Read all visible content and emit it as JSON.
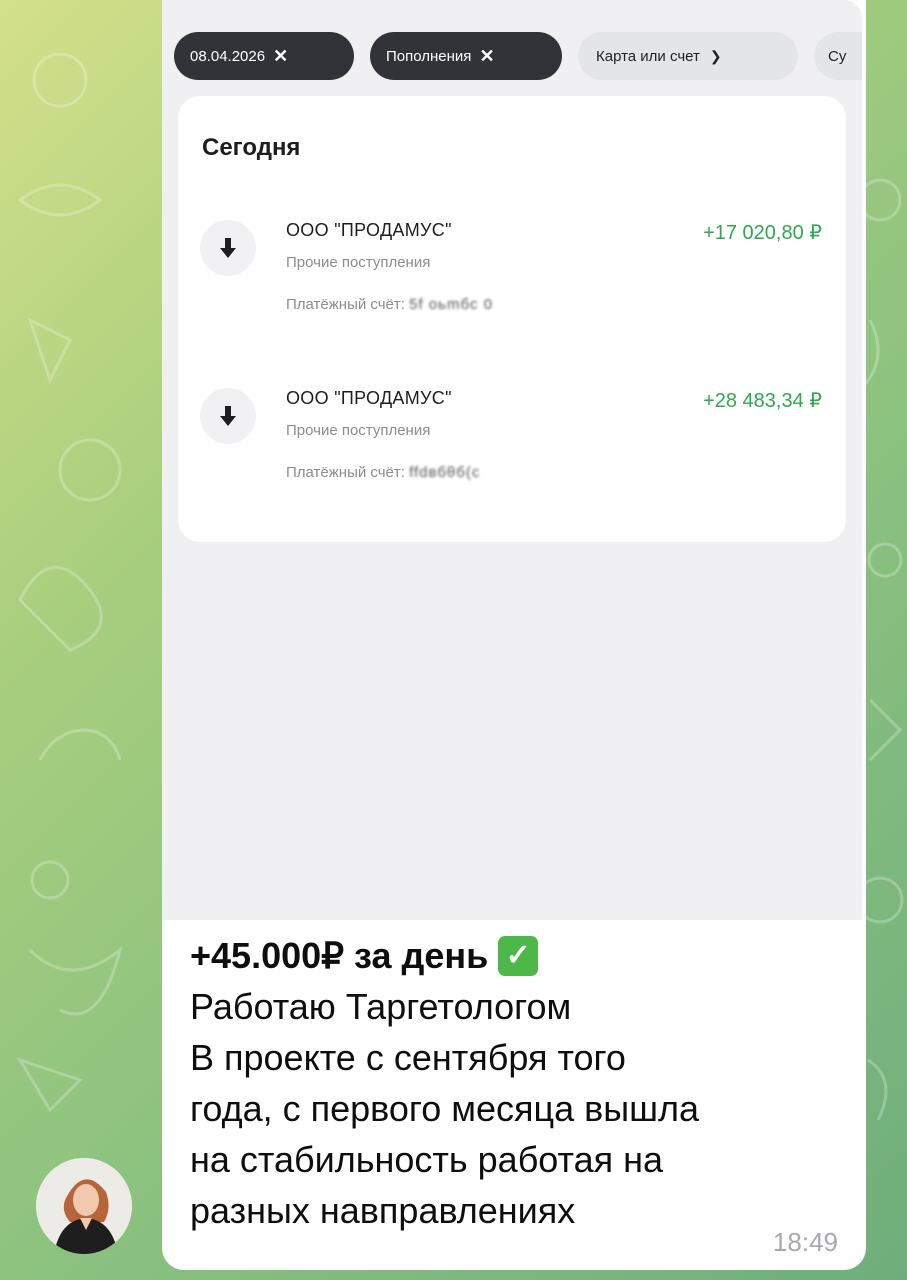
{
  "filters": {
    "date": "08.04.2026",
    "type": "Пополнения",
    "account": "Карта или счет",
    "truncated": "Су"
  },
  "card": {
    "title": "Сегодня",
    "transactions": [
      {
        "name": "ООО \"ПРОДАМУС\"",
        "category": "Прочие поступления",
        "account_label": "Платёжный счёт:",
        "account_masked": "5f oьmбc 0",
        "amount": "+17 020,80 ₽"
      },
      {
        "name": "ООО \"ПРОДАМУС\"",
        "category": "Прочие поступления",
        "account_label": "Платёжный счёт:",
        "account_masked": "ffdвбθб(c",
        "amount": "+28 483,34 ₽"
      }
    ]
  },
  "message": {
    "headline": "+45.000₽ за день",
    "lines": [
      "Работаю Таргетологом",
      "В проекте с сентября того",
      "года, с первого месяца вышла",
      "на стабильность работая на",
      "разных навправлениях"
    ],
    "time": "18:49"
  },
  "colors": {
    "amount_green": "#2fa84f",
    "chip_dark": "#313338",
    "checkmark_green": "#4cb848"
  },
  "icons": {
    "incoming": "arrow-down-icon",
    "remove_filter": "close-icon",
    "dropdown": "chevron-down-icon",
    "check": "check-mark-icon"
  }
}
